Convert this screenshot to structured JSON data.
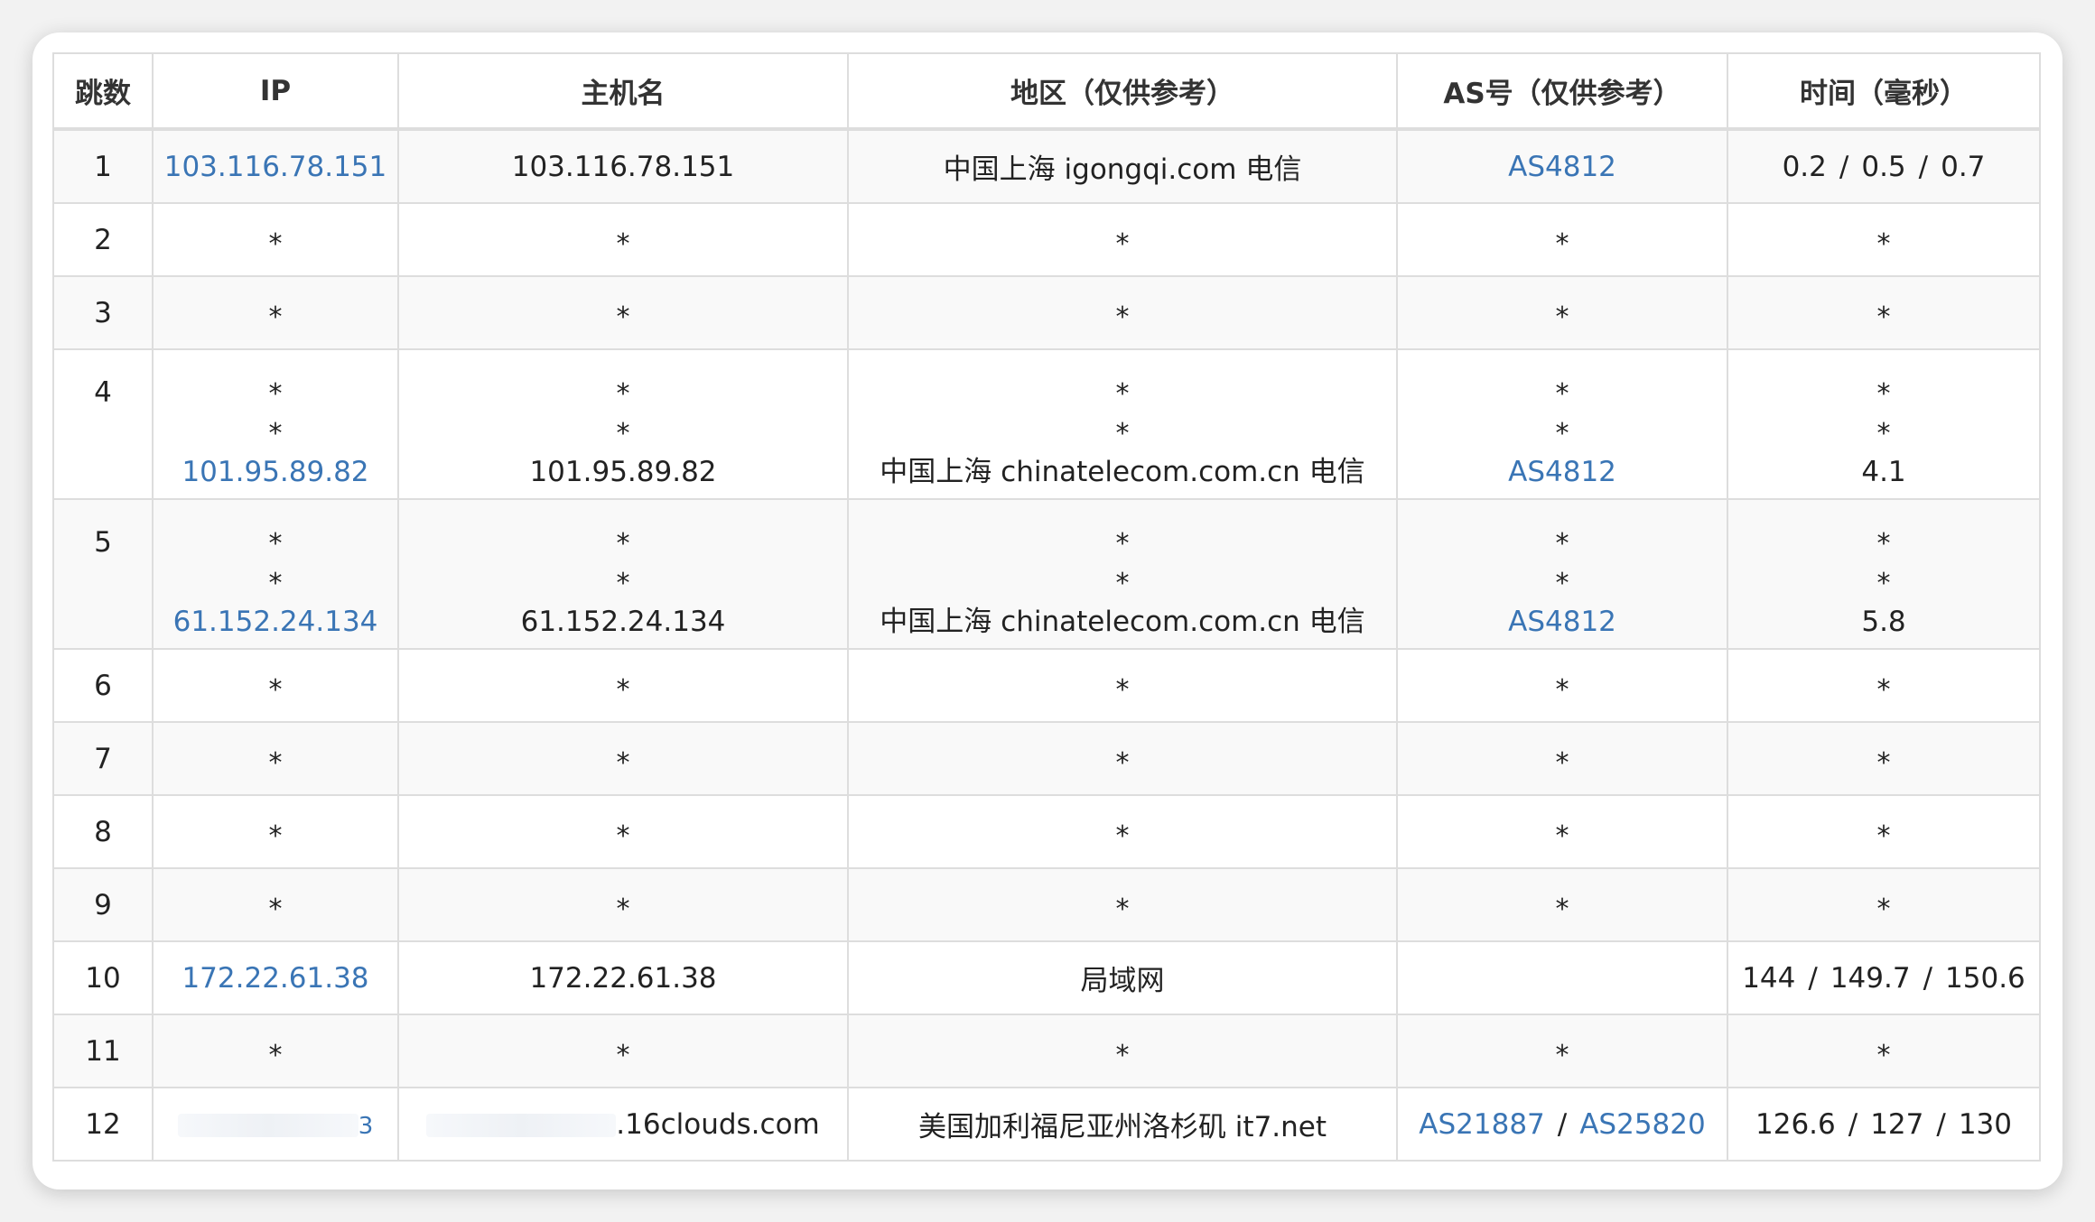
{
  "headers": [
    "跳数",
    "IP",
    "主机名",
    "地区（仅供参考）",
    "AS号（仅供参考）",
    "时间（毫秒）"
  ],
  "rows": [
    {
      "hop": "1",
      "lines": [
        {
          "ip": "103.116.78.151",
          "host": "103.116.78.151",
          "region": "中国上海 igongqi.com 电信",
          "as": [
            "AS4812"
          ],
          "time": [
            "0.2",
            "0.5",
            "0.7"
          ]
        }
      ]
    },
    {
      "hop": "2",
      "lines": [
        {
          "ip": "*",
          "host": "*",
          "region": "*",
          "as": [
            "*"
          ],
          "time": [
            "*"
          ]
        }
      ]
    },
    {
      "hop": "3",
      "lines": [
        {
          "ip": "*",
          "host": "*",
          "region": "*",
          "as": [
            "*"
          ],
          "time": [
            "*"
          ]
        }
      ]
    },
    {
      "hop": "4",
      "lines": [
        {
          "ip": "*",
          "host": "*",
          "region": "*",
          "as": [
            "*"
          ],
          "time": [
            "*"
          ]
        },
        {
          "ip": "*",
          "host": "*",
          "region": "*",
          "as": [
            "*"
          ],
          "time": [
            "*"
          ]
        },
        {
          "ip": "101.95.89.82",
          "host": "101.95.89.82",
          "region": "中国上海 chinatelecom.com.cn 电信",
          "as": [
            "AS4812"
          ],
          "time": [
            "4.1"
          ]
        }
      ]
    },
    {
      "hop": "5",
      "lines": [
        {
          "ip": "*",
          "host": "*",
          "region": "*",
          "as": [
            "*"
          ],
          "time": [
            "*"
          ]
        },
        {
          "ip": "*",
          "host": "*",
          "region": "*",
          "as": [
            "*"
          ],
          "time": [
            "*"
          ]
        },
        {
          "ip": "61.152.24.134",
          "host": "61.152.24.134",
          "region": "中国上海 chinatelecom.com.cn 电信",
          "as": [
            "AS4812"
          ],
          "time": [
            "5.8"
          ]
        }
      ]
    },
    {
      "hop": "6",
      "lines": [
        {
          "ip": "*",
          "host": "*",
          "region": "*",
          "as": [
            "*"
          ],
          "time": [
            "*"
          ]
        }
      ]
    },
    {
      "hop": "7",
      "lines": [
        {
          "ip": "*",
          "host": "*",
          "region": "*",
          "as": [
            "*"
          ],
          "time": [
            "*"
          ]
        }
      ]
    },
    {
      "hop": "8",
      "lines": [
        {
          "ip": "*",
          "host": "*",
          "region": "*",
          "as": [
            "*"
          ],
          "time": [
            "*"
          ]
        }
      ]
    },
    {
      "hop": "9",
      "lines": [
        {
          "ip": "*",
          "host": "*",
          "region": "*",
          "as": [
            "*"
          ],
          "time": [
            "*"
          ]
        }
      ]
    },
    {
      "hop": "10",
      "lines": [
        {
          "ip": "172.22.61.38",
          "host": "172.22.61.38",
          "region": "局域网",
          "as": [],
          "time": [
            "144",
            "149.7",
            "150.6"
          ]
        }
      ]
    },
    {
      "hop": "11",
      "lines": [
        {
          "ip": "*",
          "host": "*",
          "region": "*",
          "as": [
            "*"
          ],
          "time": [
            "*"
          ]
        }
      ]
    },
    {
      "hop": "12",
      "lines": [
        {
          "ip": "3",
          "ip_redacted": true,
          "host": ".16clouds.com",
          "host_redacted": true,
          "region": "美国加利福尼亚州洛杉矶 it7.net",
          "as": [
            "AS21887",
            "AS25820"
          ],
          "time": [
            "126.6",
            "127",
            "130"
          ]
        }
      ]
    }
  ]
}
